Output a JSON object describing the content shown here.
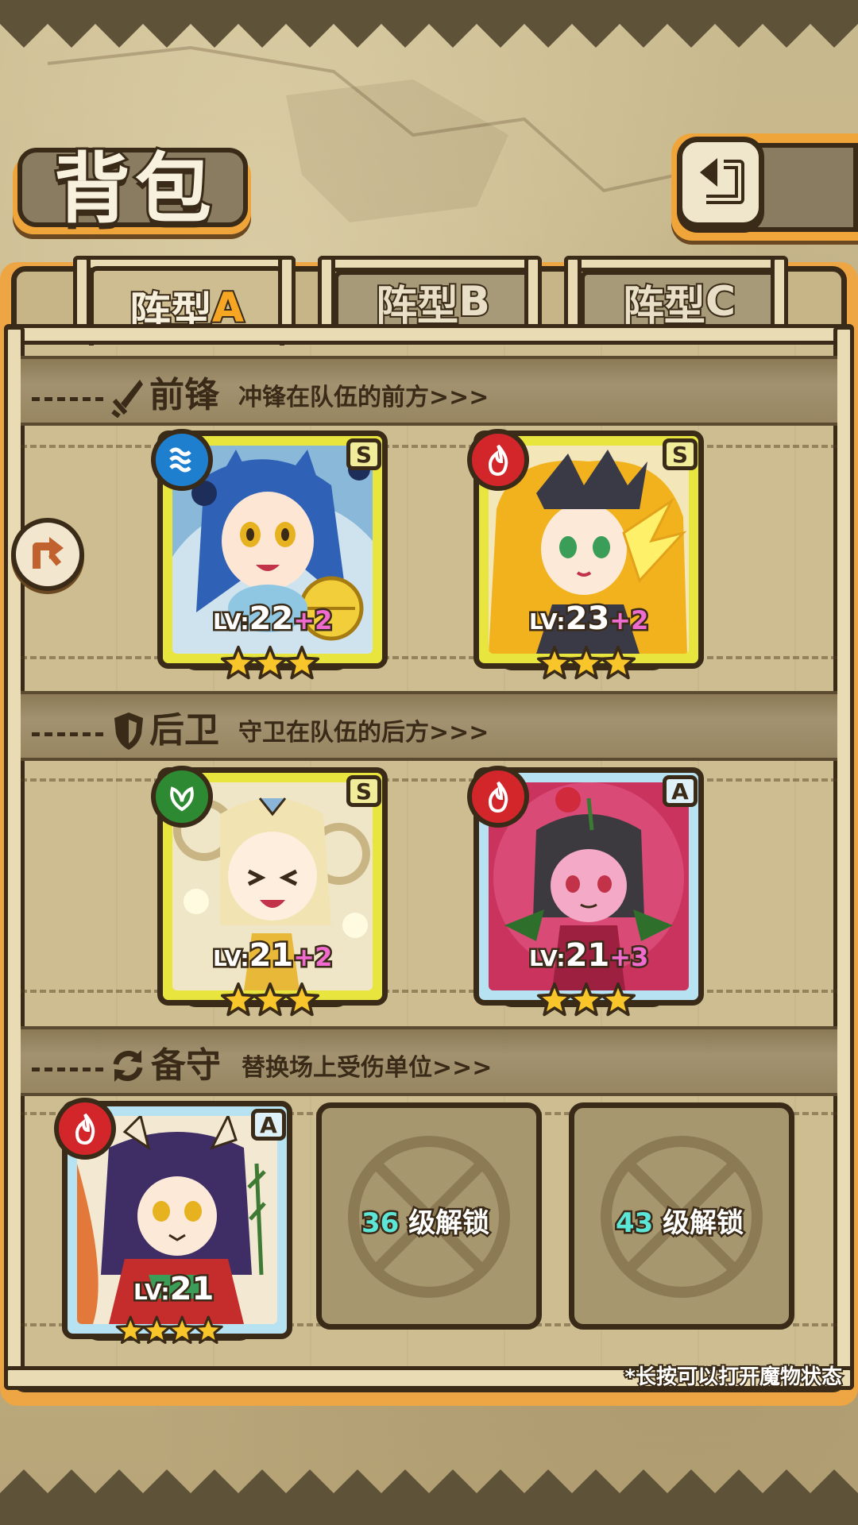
{
  "header": {
    "title": "背包"
  },
  "tabs": [
    {
      "prefix": "阵型",
      "letter": "A",
      "active": true
    },
    {
      "prefix": "阵型",
      "letter": "B",
      "active": false
    },
    {
      "prefix": "阵型",
      "letter": "C",
      "active": false
    }
  ],
  "sections": {
    "vanguard": {
      "title": "前锋",
      "description": "冲锋在队伍的前方>>>",
      "icon": "sword-icon"
    },
    "rearguard": {
      "title": "后卫",
      "description": "守卫在队伍的后方>>>",
      "icon": "shield-icon"
    },
    "reserve": {
      "title": "备守",
      "description": "替换场上受伤单位>>>",
      "icon": "swap-icon"
    }
  },
  "units": [
    {
      "slot": "vanguard-1",
      "rank": "S",
      "element": "water",
      "level_prefix": "LV:",
      "level": "22",
      "bonus": "+2",
      "stars": 3,
      "frame": "gold"
    },
    {
      "slot": "vanguard-2",
      "rank": "S",
      "element": "fire",
      "level_prefix": "LV:",
      "level": "23",
      "bonus": "+2",
      "stars": 3,
      "frame": "gold"
    },
    {
      "slot": "rearguard-1",
      "rank": "S",
      "element": "wood",
      "level_prefix": "LV:",
      "level": "21",
      "bonus": "+2",
      "stars": 3,
      "frame": "gold"
    },
    {
      "slot": "rearguard-2",
      "rank": "A",
      "element": "fire",
      "level_prefix": "LV:",
      "level": "21",
      "bonus": "+3",
      "stars": 3,
      "frame": "blue"
    },
    {
      "slot": "reserve-1",
      "rank": "A",
      "element": "fire",
      "level_prefix": "LV:",
      "level": "21",
      "bonus": "",
      "stars": 4,
      "frame": "blue"
    }
  ],
  "locked_slots": [
    {
      "level": "36",
      "label": "级解锁"
    },
    {
      "level": "43",
      "label": "级解锁"
    }
  ],
  "hint": "*长按可以打开魔物状态",
  "colors": {
    "fire": "#d3262a",
    "water": "#1f7fcf",
    "wood": "#2e8a32",
    "gold_frame": "#e9e53f",
    "blue_frame": "#b7e2f1",
    "outline": "#3a2b18",
    "accent_orange": "#f6a623",
    "bonus_pink": "#f06bcf",
    "unlock_cyan": "#5ce6d8"
  }
}
